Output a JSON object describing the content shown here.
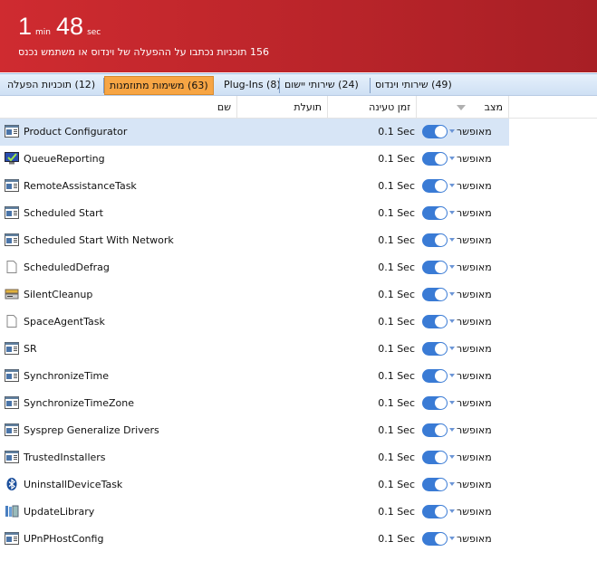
{
  "header": {
    "minutes": "1",
    "min_label": "min",
    "seconds": "48",
    "sec_label": "sec",
    "subtitle": "156 תוכניות נכתבו על ההפעלה של וינדוס או משתמש נכנס"
  },
  "tabs": [
    {
      "label": "(12) תוכניות הפעלה"
    },
    {
      "label": "(63) משימות מתוזמנות"
    },
    {
      "label": "Plug-Ins (8)"
    },
    {
      "label": "(24) שירותי יישום"
    },
    {
      "label": "(49) שירותי וינדוס"
    }
  ],
  "columns": {
    "name": "שם",
    "usefulness": "תועלת",
    "load_time": "זמן טעינה",
    "status": "מצב"
  },
  "rows": [
    {
      "name": "Product Configurator",
      "load": "0.1 Sec",
      "status": "מאופשר",
      "icon": "window"
    },
    {
      "name": "QueueReporting",
      "load": "0.1 Sec",
      "status": "מאופשר",
      "icon": "monitor"
    },
    {
      "name": "RemoteAssistanceTask",
      "load": "0.1 Sec",
      "status": "מאופשר",
      "icon": "window"
    },
    {
      "name": "Scheduled Start",
      "load": "0.1 Sec",
      "status": "מאופשר",
      "icon": "window"
    },
    {
      "name": "Scheduled Start With Network",
      "load": "0.1 Sec",
      "status": "מאופשר",
      "icon": "window"
    },
    {
      "name": "ScheduledDefrag",
      "load": "0.1 Sec",
      "status": "מאופשר",
      "icon": "document"
    },
    {
      "name": "SilentCleanup",
      "load": "0.1 Sec",
      "status": "מאופשר",
      "icon": "cleanup"
    },
    {
      "name": "SpaceAgentTask",
      "load": "0.1 Sec",
      "status": "מאופשר",
      "icon": "document"
    },
    {
      "name": "SR",
      "load": "0.1 Sec",
      "status": "מאופשר",
      "icon": "window"
    },
    {
      "name": "SynchronizeTime",
      "load": "0.1 Sec",
      "status": "מאופשר",
      "icon": "window"
    },
    {
      "name": "SynchronizeTimeZone",
      "load": "0.1 Sec",
      "status": "מאופשר",
      "icon": "window"
    },
    {
      "name": "Sysprep Generalize Drivers",
      "load": "0.1 Sec",
      "status": "מאופשר",
      "icon": "window"
    },
    {
      "name": "TrustedInstallers",
      "load": "0.1 Sec",
      "status": "מאופשר",
      "icon": "window"
    },
    {
      "name": "UninstallDeviceTask",
      "load": "0.1 Sec",
      "status": "מאופשר",
      "icon": "bluetooth"
    },
    {
      "name": "UpdateLibrary",
      "load": "0.1 Sec",
      "status": "מאופשר",
      "icon": "library"
    },
    {
      "name": "UPnPHostConfig",
      "load": "0.1 Sec",
      "status": "מאופשר",
      "icon": "window"
    }
  ]
}
